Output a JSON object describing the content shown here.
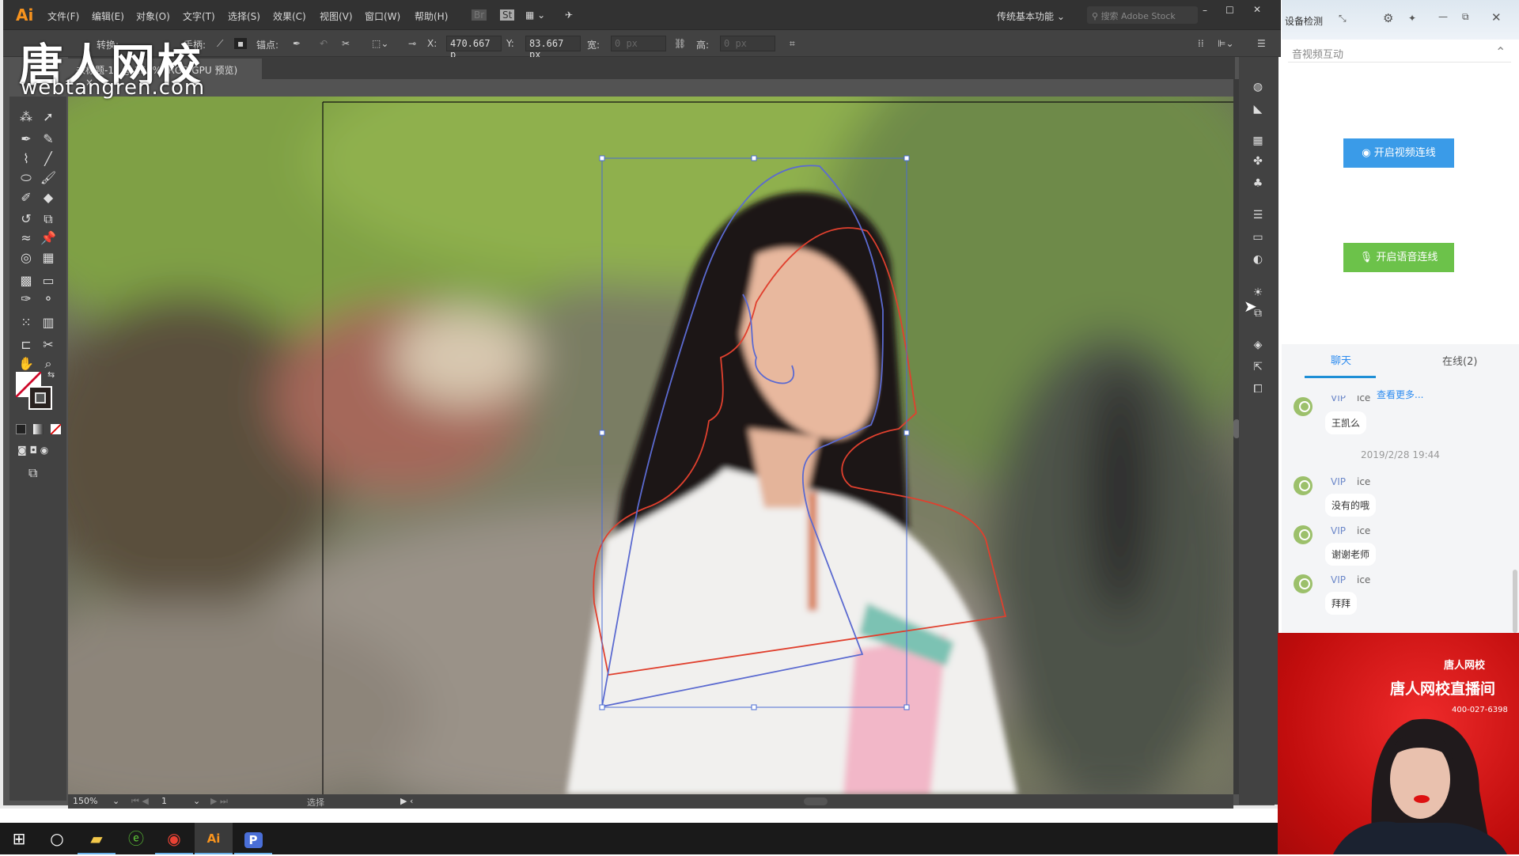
{
  "app": {
    "logo": "Ai",
    "menus": [
      "文件(F)",
      "编辑(E)",
      "对象(O)",
      "文字(T)",
      "选择(S)",
      "效果(C)",
      "视图(V)",
      "窗口(W)",
      "帮助(H)"
    ],
    "bridge_labels": [
      "Br",
      "St"
    ],
    "workspace": "传统基本功能",
    "search_placeholder": "搜索 Adobe Stock"
  },
  "options": {
    "convert_label": "转换:",
    "handles_label": "手柄:",
    "anchor_label": "锚点:",
    "x_label": "X:",
    "x_value": "470.667 p",
    "y_label": "Y:",
    "y_value": "83.667 px",
    "w_label": "宽:",
    "w_value": "0 px",
    "h_label": "高:",
    "h_value": "0 px"
  },
  "document": {
    "tab_title": "未标题-1* @ 150% (RGB/GPU 预览)",
    "close": "×"
  },
  "watermark": {
    "brand": "唐人网校",
    "url": "webtangren.com"
  },
  "toolbar": {
    "tools": [
      {
        "name": "magic-wand-icon",
        "g": "⁂"
      },
      {
        "name": "lasso-icon",
        "g": "➚"
      },
      {
        "name": "pen-icon",
        "g": "✒"
      },
      {
        "name": "curvature-icon",
        "g": "✎"
      },
      {
        "name": "type-on-path-icon",
        "g": "⌇"
      },
      {
        "name": "line-segment-icon",
        "g": "╱"
      },
      {
        "name": "ellipse-icon",
        "g": "⬭"
      },
      {
        "name": "paintbrush-icon",
        "g": "🖌"
      },
      {
        "name": "shaper-icon",
        "g": "✐"
      },
      {
        "name": "eraser-icon",
        "g": "◆"
      },
      {
        "name": "rotate-icon",
        "g": "↺"
      },
      {
        "name": "scale-icon",
        "g": "⧉"
      },
      {
        "name": "puppet-warp-icon",
        "g": "≈"
      },
      {
        "name": "pin-icon",
        "g": "📌"
      },
      {
        "name": "shape-builder-icon",
        "g": "◎"
      },
      {
        "name": "perspective-grid-icon",
        "g": "▦"
      },
      {
        "name": "mesh-icon",
        "g": "▩"
      },
      {
        "name": "gradient-icon",
        "g": "▭"
      },
      {
        "name": "eyedropper-icon",
        "g": "✑"
      },
      {
        "name": "blend-icon",
        "g": "⚬"
      },
      {
        "name": "symbol-sprayer-icon",
        "g": "⁙"
      },
      {
        "name": "column-graph-icon",
        "g": "▥"
      },
      {
        "name": "artboard-icon",
        "g": "⊏"
      },
      {
        "name": "knife-icon",
        "g": "✂"
      },
      {
        "name": "hand-icon",
        "g": "✋"
      },
      {
        "name": "zoom-icon",
        "g": "⌕"
      }
    ]
  },
  "status": {
    "zoom": "150%",
    "page": "1",
    "tool": "选择"
  },
  "chat": {
    "header": "设备检测",
    "section": "音视频互动",
    "video_btn": "开启视频连线",
    "audio_btn": "开启语音连线",
    "tab_chat": "聊天",
    "tab_online": "在线(2)",
    "more": "查看更多...",
    "timestamp": "2019/2/28 19:44",
    "first_msg": {
      "vip": "VIP",
      "nick": "ice",
      "text": "王凯么"
    },
    "messages": [
      {
        "vip": "VIP",
        "nick": "ice",
        "text": "没有的哦"
      },
      {
        "vip": "VIP",
        "nick": "ice",
        "text": "谢谢老师"
      },
      {
        "vip": "VIP",
        "nick": "ice",
        "text": "拜拜"
      }
    ],
    "accent": "#2d8cf0",
    "video_btn_color": "#3a9be8",
    "audio_btn_color": "#6cc24a"
  },
  "video": {
    "title": "唐人网校直播间",
    "brand": "唐人网校",
    "phone": "400-027-6398"
  },
  "taskbar": [
    "start",
    "search",
    "file-explorer",
    "browser-360",
    "chrome",
    "illustrator",
    "pp-assistant"
  ]
}
